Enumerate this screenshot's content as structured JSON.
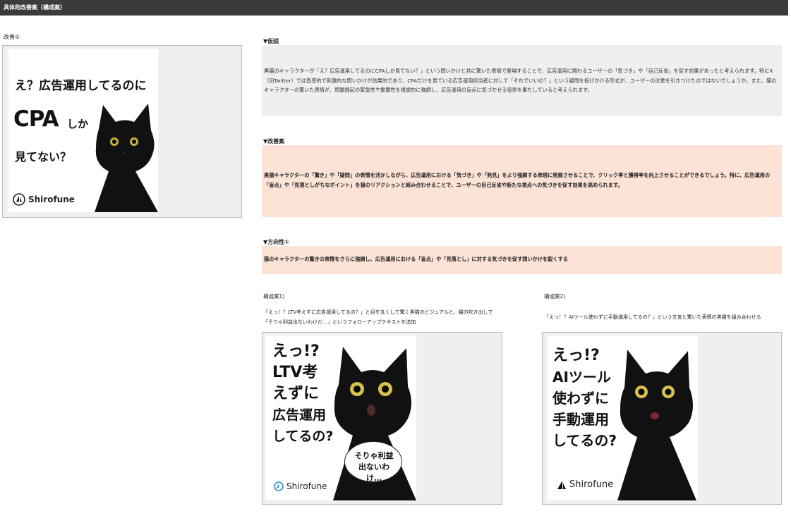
{
  "header": {
    "title": "具体的改善案（構成案）"
  },
  "improvement": {
    "label": "改善①",
    "ad": {
      "line1": "え？広告運用してるのに",
      "line2_big": "CPA",
      "line2_small": "しか",
      "line3": "見てない？",
      "brand": "Shirofune"
    }
  },
  "hypothesis": {
    "heading": "▼仮説",
    "text": "黒猫のキャラクターが「え？広告運用してるのにCPAしか見てない？」という問いかけと共に驚いた表情で登場することで、広告運用に関わるユーザーの「気づき」や「自己反省」を促す効果があったと考えられます。特にX（旧Twitter）では直感的で刺激的な問いかけが効果的であり、CPAだけを見ている広告運用担当者に対して「それでいいの？」という疑問を投げかける形式が、ユーザーの注意を引きつけたのではないでしょうか。また、猫のキャラクターの驚いた表情が、問題提起の緊急性や重要性を視覚的に強調し、広告運用の盲点に気づかせる役割を果たしていると考えられます。"
  },
  "proposal": {
    "heading": "▼改善案",
    "text": "黒猫キャラクターの「驚き」や「疑問」の表情を活かしながら、広告運用における「気づき」や「発見」をより強調する表現に発展させることで、クリック率と獲得率を向上させることができるでしょう。特に、広告運用の「盲点」や「見落としがちなポイント」を猫のリアクションと組み合わせることで、ユーザーの自己反省や新たな視点への気づきを促す効果を高められます。"
  },
  "direction": {
    "heading": "▼方向性①",
    "text": "猫のキャラクターの驚きの表情をさらに強調し、広告運用における「盲点」や「見落とし」に対する気づきを促す問いかけを鋭くする"
  },
  "plan1": {
    "label": "構成案1)",
    "desc_line1": "「えっ！？LTV考えずに広告運用してるの？」と目を丸くして驚く黒猫のビジュアルと、猫の吹き出しで",
    "desc_line2": "「そりゃ利益出ないわけだ…」というフォローアップテキストを追加",
    "ad": {
      "lines": [
        "えっ!?",
        "LTV考",
        "えずに",
        "広告運用",
        "してるの?"
      ],
      "bubble1": "そりゃ利益",
      "bubble2": "出ないわけ…",
      "brand": "Shirofune"
    }
  },
  "plan2": {
    "label": "構成案2)",
    "desc": "「えっ！？AIツール使わずに手動運用してるの？」という文言と驚いた表情の黒猫を組み合わせる",
    "ad": {
      "lines": [
        "えっ!?",
        "AIツール",
        "使わずに",
        "手動運用",
        "してるの?"
      ],
      "brand": "Shirofune"
    }
  },
  "colors": {
    "topbar": "#3b3b3b",
    "grey_panel": "#efefef",
    "pink_panel": "#fde2d6"
  },
  "icons": [
    "shirofune-logo-icon",
    "black-cat-illustration"
  ]
}
